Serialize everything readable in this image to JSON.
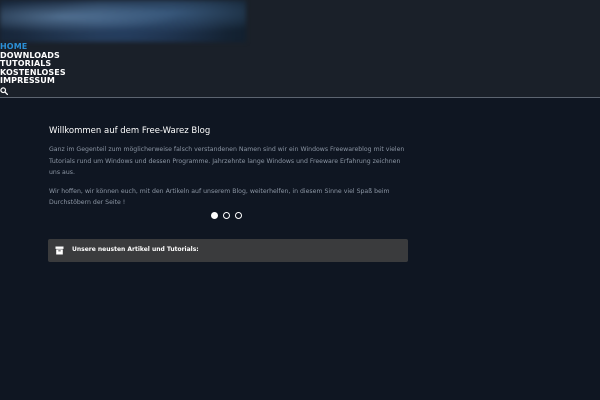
{
  "nav": {
    "items": [
      {
        "label": "HOME",
        "active": true
      },
      {
        "label": "DOWNLOADS"
      },
      {
        "label": "TUTORIALS"
      },
      {
        "label": "KOSTENLOSES"
      },
      {
        "label": "IMPRESSUM"
      }
    ],
    "search_icon": "search-icon"
  },
  "welcome": {
    "title": "Willkommen auf dem Free-Warez Blog",
    "paragraph1": "Ganz im Gegenteil zum möglicherweise falsch verstandenen Namen sind wir ein Windows Freewareblog mit vielen Tutorials rund um Windows und dessen Programme. Jahrzehnte lange Windows und Freeware Erfahrung zeichnen uns aus.",
    "paragraph2": "Wir hoffen, wir können euch, mit den Artikeln auf unserem Blog, weiterhelfen, in diesem Sinne viel Spaß beim Durchstöbern der Seite !"
  },
  "slider": {
    "dot_count": 3,
    "active_index": 0
  },
  "articles": {
    "label": "Unsere neusten Artikel und Tutorials:",
    "icon": "archive-box-icon"
  },
  "colors": {
    "background": "#0f1622",
    "header": "#1a2029",
    "nav_active": "#2b8fd6",
    "text_muted": "#8b95a3",
    "bar": "#3a3b3d"
  }
}
